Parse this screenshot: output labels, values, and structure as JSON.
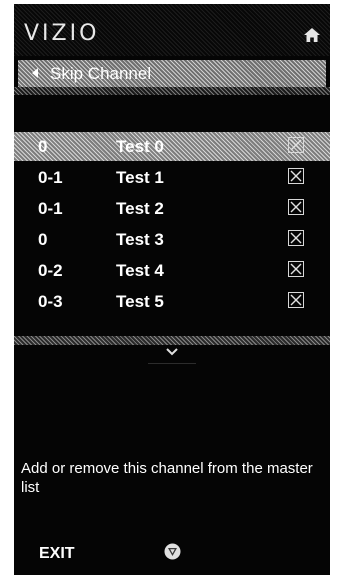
{
  "header": {
    "logo_text": "VIZIO",
    "home_icon": "home-icon"
  },
  "titlebar": {
    "back_icon": "back-arrow-icon",
    "title": "Skip Channel"
  },
  "channels": [
    {
      "number": "0",
      "name": "Test 0",
      "skipped": false,
      "selected": true
    },
    {
      "number": "0-1",
      "name": "Test 1",
      "skipped": false,
      "selected": false
    },
    {
      "number": "0-1",
      "name": "Test 2",
      "skipped": false,
      "selected": false
    },
    {
      "number": "0",
      "name": "Test 3",
      "skipped": false,
      "selected": false
    },
    {
      "number": "0-2",
      "name": "Test 4",
      "skipped": false,
      "selected": false
    },
    {
      "number": "0-3",
      "name": "Test 5",
      "skipped": false,
      "selected": false
    }
  ],
  "scroll": {
    "down_icon": "chevron-down-icon"
  },
  "help": {
    "text": "Add or remove this channel from the master list"
  },
  "footer": {
    "exit_label": "EXIT",
    "vizio_button_icon": "vizio-v-button-icon"
  }
}
